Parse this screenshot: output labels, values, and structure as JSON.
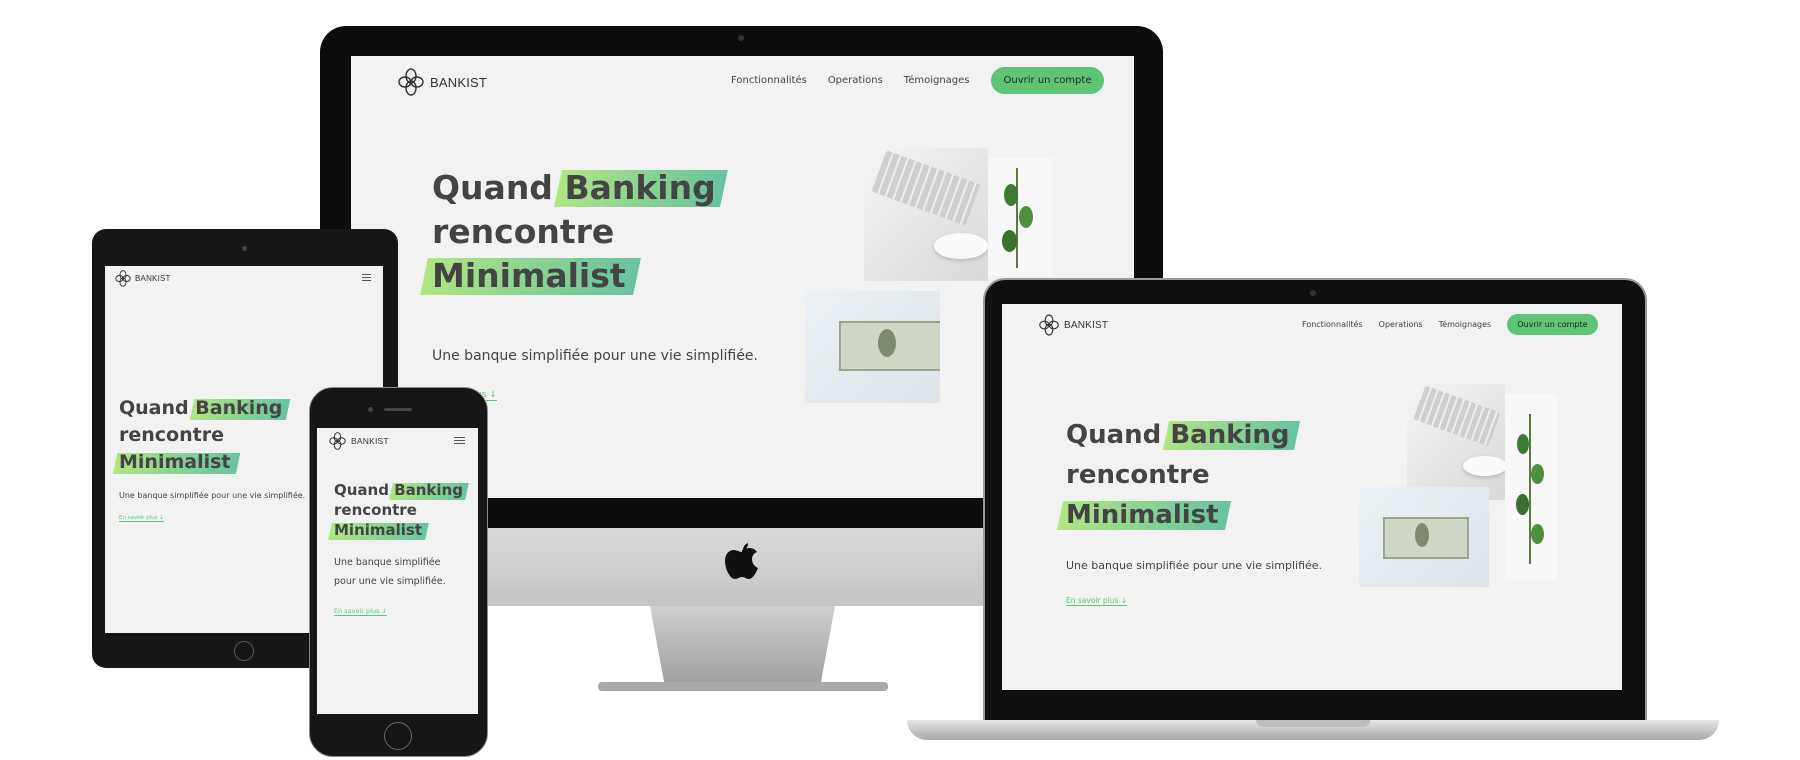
{
  "site": {
    "brand": "BANKIST",
    "nav": [
      "Fonctionnalités",
      "Operations",
      "Témoignages"
    ],
    "cta": "Ouvrir un compte",
    "hero": {
      "w1": "Quand",
      "w2": "Banking",
      "w3": "rencontre",
      "w4": "Minimalist"
    },
    "subtitle": "Une banque simplifiée pour une vie simplifiée.",
    "subtitle_line1": "Une banque simplifiée",
    "subtitle_line2": "pour une vie simplifiée.",
    "more": "En savoir plus ↓",
    "more_partial": "us ↓"
  },
  "icons": {
    "logo": "four-petal-flower-icon",
    "menu": "hamburger-menu-icon",
    "apple": "apple-logo-icon"
  },
  "colors": {
    "accent": "#5ec576",
    "accent_light": "#9be15d",
    "page_bg": "#f2f2f2",
    "text": "#444444"
  }
}
